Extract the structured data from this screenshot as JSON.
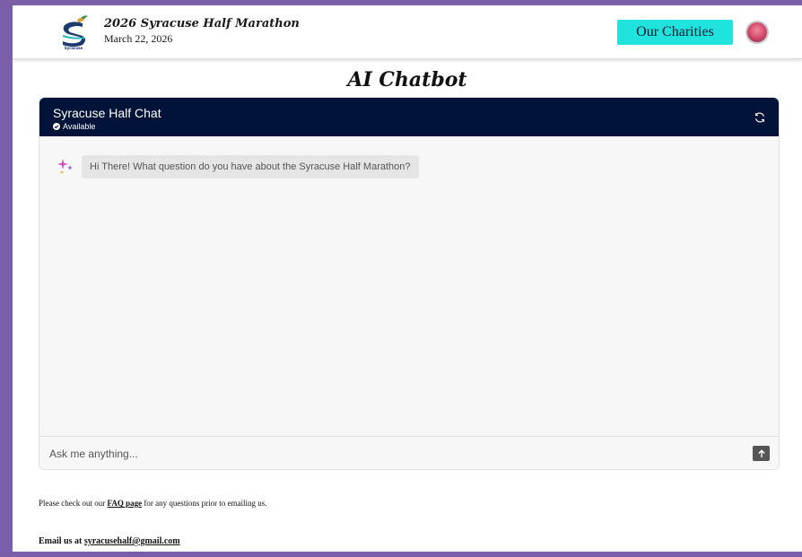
{
  "header": {
    "event_title": "2026 Syracuse Half Marathon",
    "event_date": "March 22, 2026",
    "charities_label": "Our Charities",
    "logo_text": "Syracuse",
    "logo_icon": "syracuse-half-logo",
    "avatar_icon": "profile-avatar"
  },
  "page": {
    "title": "AI Chatbot"
  },
  "chat": {
    "name": "Syracuse Half Chat",
    "status": "Available",
    "status_icon": "check-circle-icon",
    "refresh_icon": "refresh-icon",
    "messages": [
      {
        "sender": "bot",
        "icon": "sparkle-icon",
        "text": "Hi There! What question do you have about the Syracuse Half Marathon?"
      }
    ],
    "input_placeholder": "Ask me anything...",
    "send_icon": "arrow-up-icon"
  },
  "footer": {
    "faq_prefix": "Please check out our ",
    "faq_link": "FAQ page",
    "faq_suffix": " for any questions prior to emailing us.",
    "email_prefix": "Email us at ",
    "email_link": "syracusehalf@gmail.com"
  },
  "colors": {
    "frame": "#7a5ea8",
    "accent": "#1fe3dc",
    "chat_header": "#011338",
    "bubble": "#e5e5e5"
  }
}
